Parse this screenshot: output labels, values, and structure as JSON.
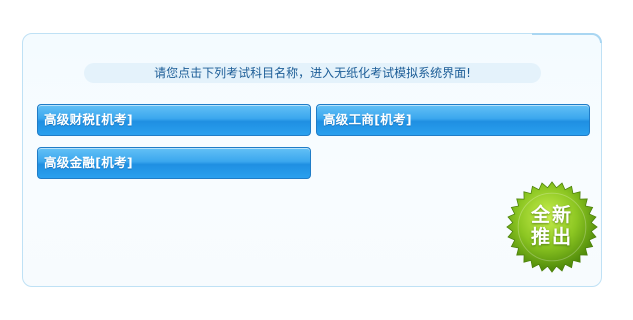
{
  "notice": {
    "text": "请您点击下列考试科目名称，进入无纸化考试模拟系统界面!"
  },
  "exams": [
    {
      "label": "高级财税[机考]"
    },
    {
      "label": "高级工商[机考]"
    },
    {
      "label": "高级金融[机考]"
    }
  ],
  "badge": {
    "line1": "全新",
    "line2": "推出",
    "color_light": "#b4e43a",
    "color_dark": "#5a9a0c"
  },
  "colors": {
    "button": "#2a9ded",
    "panel_border": "#bfe1f5",
    "notice_text": "#1c5d97"
  }
}
